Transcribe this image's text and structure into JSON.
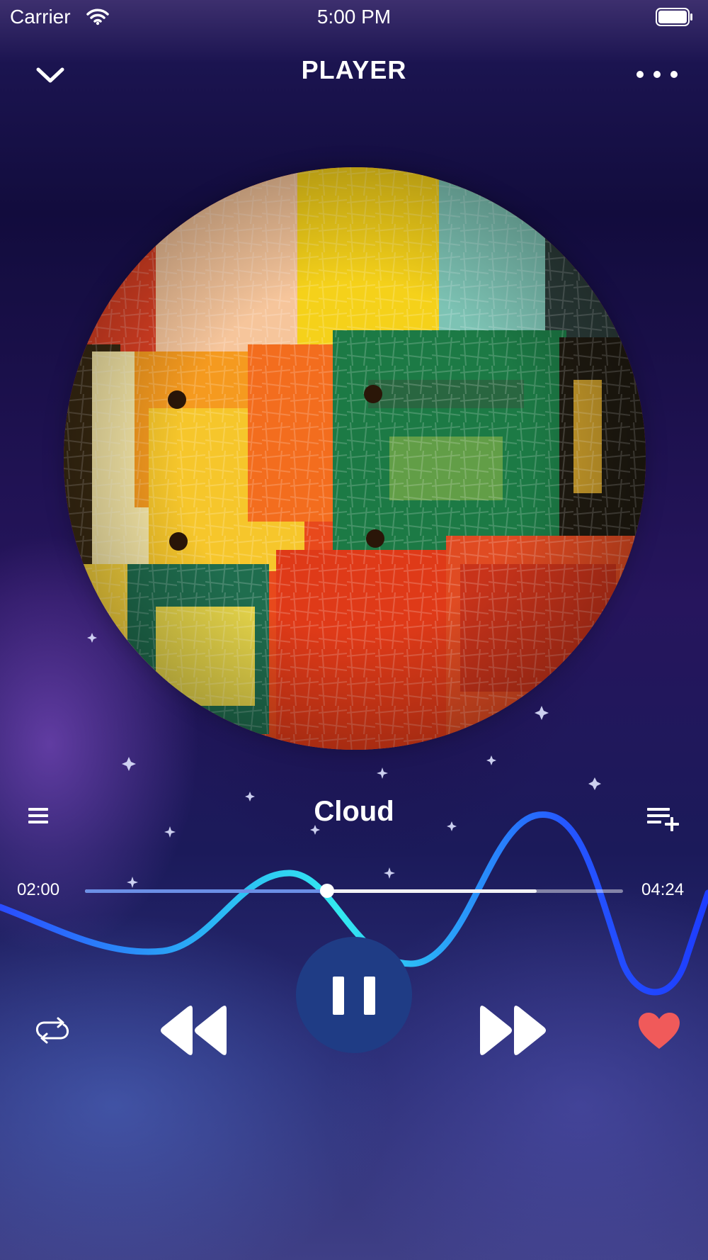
{
  "status_bar": {
    "carrier": "Carrier",
    "time": "5:00 PM",
    "wifi_icon": "wifi-icon",
    "battery_icon": "battery-icon"
  },
  "nav": {
    "title": "PLAYER",
    "back_icon": "chevron-down-icon",
    "more_icon": "more-horizontal-icon"
  },
  "track": {
    "title": "Cloud",
    "elapsed": "02:00",
    "duration": "04:24",
    "progress": 0.45,
    "buffered": 0.84
  },
  "controls": {
    "playlist_icon": "playlist-icon",
    "add_to_queue_icon": "add-to-queue-icon",
    "repeat_icon": "repeat-icon",
    "previous_icon": "rewind-icon",
    "play_pause_icon": "pause-icon",
    "next_icon": "fast-forward-icon",
    "like_icon": "heart-icon"
  },
  "colors": {
    "accent": "#1f3c85",
    "wave_start": "#2a5cff",
    "wave_mid": "#2ee6f2",
    "like": "#f05a5a",
    "progress_played": "#6b8fe6"
  }
}
